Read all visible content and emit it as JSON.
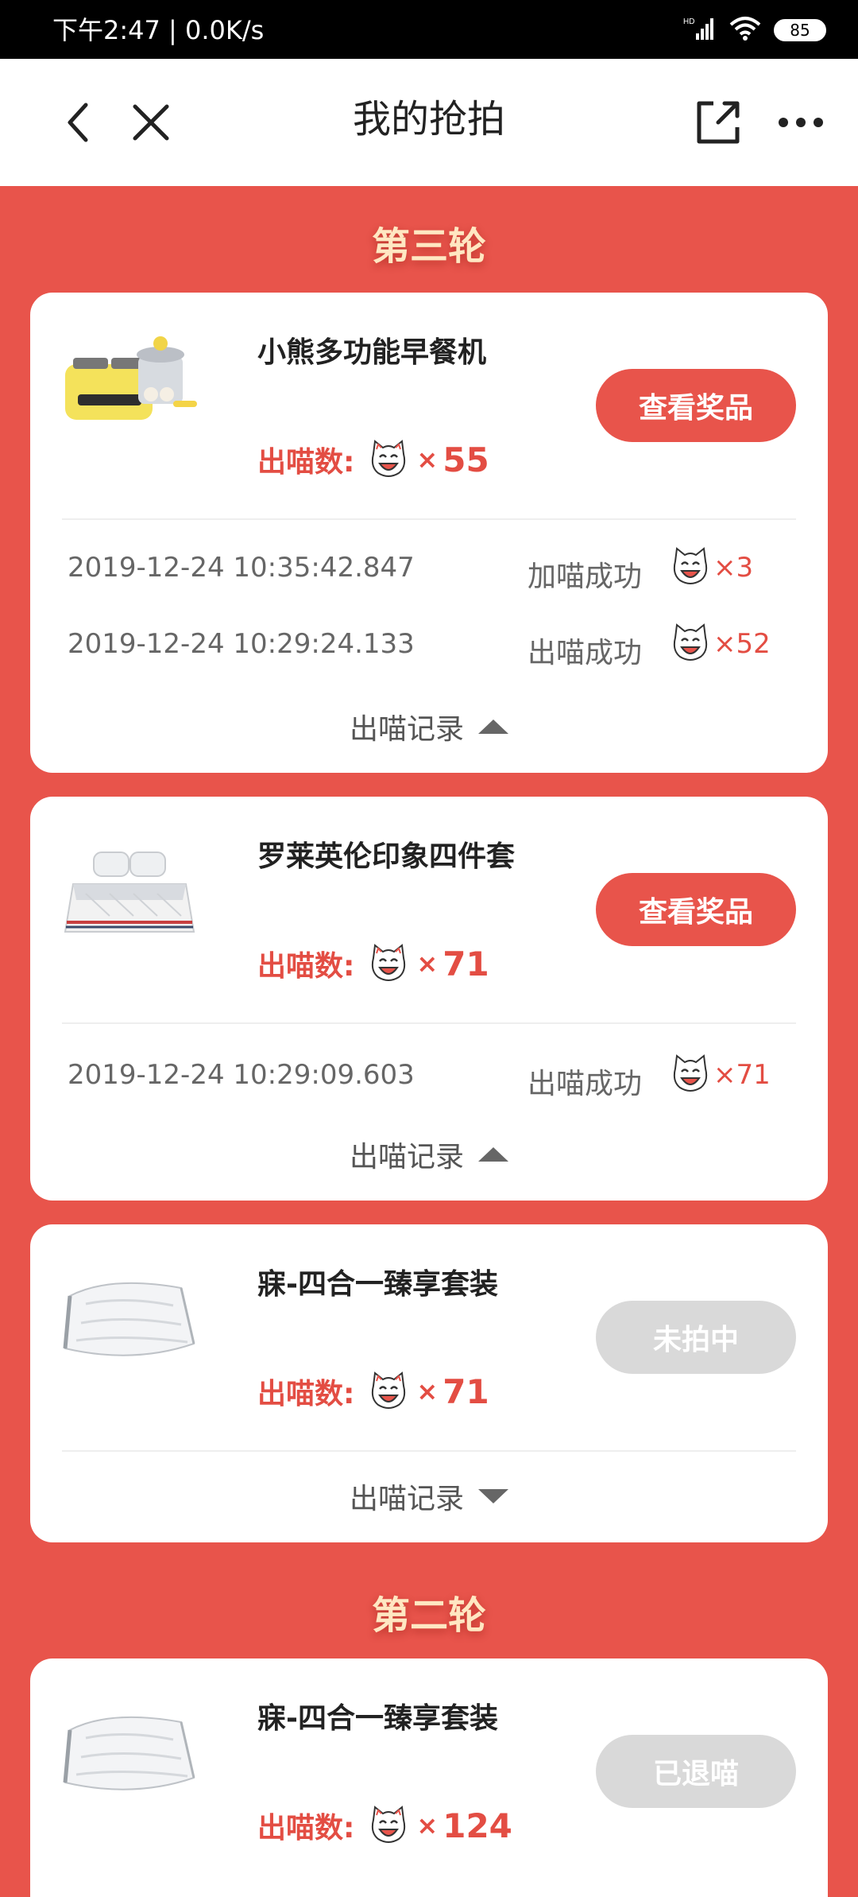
{
  "status_bar": {
    "time": "下午2:47 | 0.0K/s",
    "battery": "85",
    "network": "HD"
  },
  "nav": {
    "title": "我的抢拍"
  },
  "labels": {
    "count_label": "出喵数:",
    "times": "×",
    "toggle_label": "出喵记录"
  },
  "sections": [
    {
      "title": "第三轮"
    },
    {
      "title": "第二轮"
    }
  ],
  "cards": [
    {
      "name": "小熊多功能早餐机",
      "count": "55",
      "button": "查看奖品",
      "button_state": "active",
      "records": [
        {
          "time": "2019-12-24 10:35:42.847",
          "status": "加喵成功",
          "count": "×3"
        },
        {
          "time": "2019-12-24 10:29:24.133",
          "status": "出喵成功",
          "count": "×52"
        }
      ],
      "expanded": true
    },
    {
      "name": "罗莱英伦印象四件套",
      "count": "71",
      "button": "查看奖品",
      "button_state": "active",
      "records": [
        {
          "time": "2019-12-24 10:29:09.603",
          "status": "出喵成功",
          "count": "×71"
        }
      ],
      "expanded": true
    },
    {
      "name": "寐-四合一臻享套装",
      "count": "71",
      "button": "未拍中",
      "button_state": "disabled",
      "expanded": false
    },
    {
      "name": "寐-四合一臻享套装",
      "count": "124",
      "button": "已退喵",
      "button_state": "disabled"
    }
  ],
  "colors": {
    "accent": "#e8544b",
    "count_red": "#e34d43",
    "section_title": "#ffe7c2",
    "disabled": "#d9d9d9"
  }
}
